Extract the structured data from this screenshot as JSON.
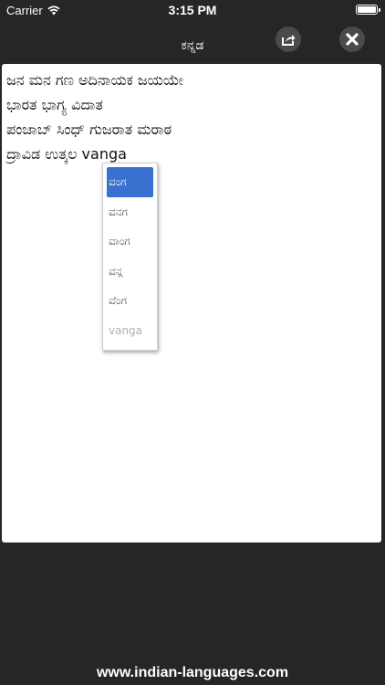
{
  "status_bar": {
    "carrier": "Carrier",
    "time": "3:15 PM",
    "icons": [
      "wifi-icon",
      "battery-icon"
    ]
  },
  "header": {
    "title": "ಕನ್ನಡ",
    "share_icon": "share-icon",
    "close_icon": "close-icon"
  },
  "editor": {
    "lines": [
      "ಜನ ಮನ ಗಣ ಅದಿನಾಯಕ ಜಯಯೇ",
      "ಭಾರತ ಭಾಗ್ಯ ವಿದಾತ",
      "ಪಂಜಾಬ್ ಸಿಂಧ್ ಗುಜರಾತ ಮರಾಠ",
      "ದ್ರಾವಿಡ ಉತ್ಕಲ vanga"
    ]
  },
  "suggestions": [
    "ವಂಗ",
    "ವನಗ",
    "ವಾಂಗ",
    "ವನ್ಗ",
    "ವೆಂಗ",
    "vanga"
  ],
  "footer": {
    "text": "www.indian-languages.com"
  },
  "colors": {
    "background": "#262626",
    "selected": "#3a70cf"
  }
}
